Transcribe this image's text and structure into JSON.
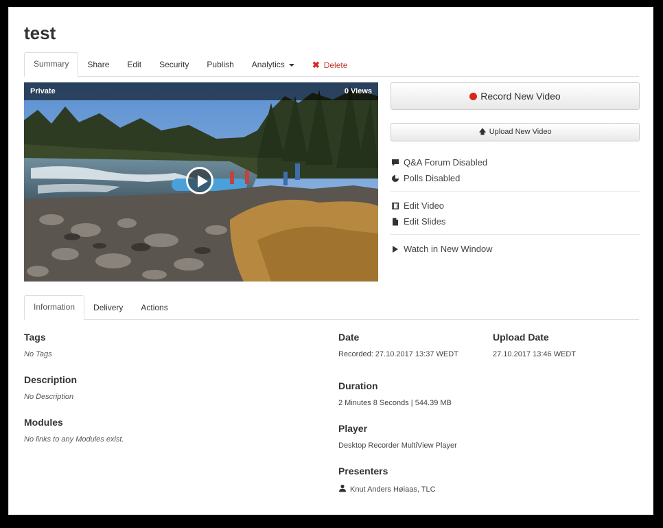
{
  "page_title": "test",
  "top_tabs": [
    {
      "label": "Summary",
      "active": true
    },
    {
      "label": "Share"
    },
    {
      "label": "Edit"
    },
    {
      "label": "Security"
    },
    {
      "label": "Publish"
    },
    {
      "label": "Analytics"
    },
    {
      "label": "Delete"
    }
  ],
  "video": {
    "privacy": "Private",
    "views": "0 Views"
  },
  "actions": {
    "record_label": "Record New Video",
    "upload_label": "Upload New Video",
    "qa_forum": "Q&A Forum Disabled",
    "polls": "Polls Disabled",
    "edit_video": "Edit Video",
    "edit_slides": "Edit Slides",
    "watch_new_window": "Watch in New Window"
  },
  "bottom_tabs": [
    {
      "label": "Information",
      "active": true
    },
    {
      "label": "Delivery"
    },
    {
      "label": "Actions"
    }
  ],
  "info": {
    "tags_title": "Tags",
    "tags_value": "No Tags",
    "description_title": "Description",
    "description_value": "No Description",
    "modules_title": "Modules",
    "modules_value": "No links to any Modules exist.",
    "date_title": "Date",
    "date_value": "Recorded: 27.10.2017 13:37 WEDT",
    "upload_date_title": "Upload Date",
    "upload_date_value": "27.10.2017 13:46 WEDT",
    "duration_title": "Duration",
    "duration_value": "2 Minutes 8 Seconds | 544.39 MB",
    "player_title": "Player",
    "player_value": "Desktop Recorder MultiView Player",
    "presenters_title": "Presenters",
    "presenters_value": "Knut Anders Høiaas, TLC"
  },
  "icons": {
    "record": "record-dot-icon",
    "upload": "upload-arrow-icon",
    "qa": "comment-icon",
    "polls": "pie-chart-icon",
    "edit_video": "film-icon",
    "edit_slides": "file-icon",
    "watch": "play-icon",
    "presenter": "user-icon",
    "delete": "close-icon"
  },
  "colors": {
    "record_red": "#d9271d",
    "delete_red": "#c0392b"
  }
}
